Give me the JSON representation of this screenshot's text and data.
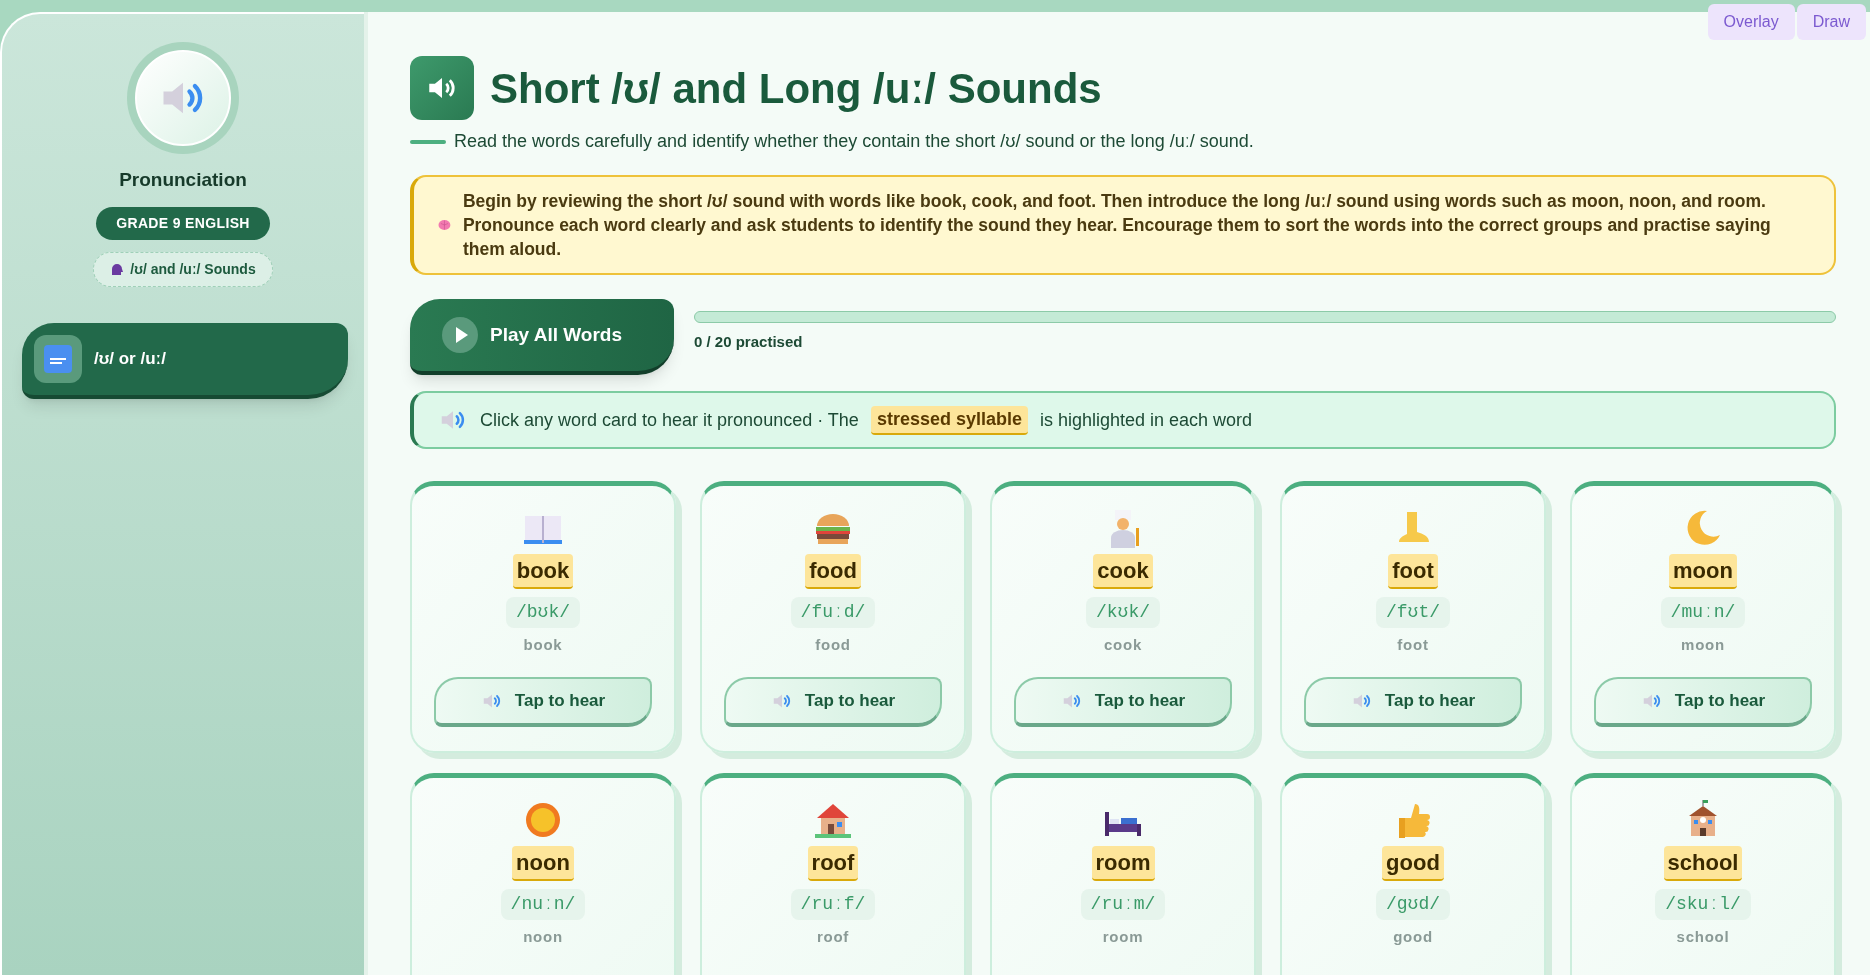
{
  "top_buttons": [
    {
      "label": "Overlay"
    },
    {
      "label": "Draw"
    }
  ],
  "sidebar": {
    "title": "Pronunciation",
    "badge": "GRADE 9 ENGLISH",
    "topic": "/ʊ/ and /uː/ Sounds",
    "items": [
      {
        "label": "/ʊ/ or /uː/",
        "selected": true
      }
    ]
  },
  "header": {
    "title": "Short /ʊ/ and Long /uː/ Sounds",
    "subtitle": "Read the words carefully and identify whether they contain the short /ʊ/ sound or the long /uː/ sound."
  },
  "teacher_note": "Begin by reviewing the short /ʊ/ sound with words like book, cook, and foot. Then introduce the long /uː/ sound using words such as moon, noon, and room. Pronounce each word clearly and ask students to identify the sound they hear. Encourage them to sort the words into the correct groups and practise saying them aloud.",
  "play_all": {
    "label": "Play All Words"
  },
  "progress": {
    "level": 0,
    "reading": "0 / 20 practised"
  },
  "tip": {
    "before": "Click any word card to hear it pronounced · The",
    "highlight": "stressed syllable",
    "after": "is highlighted in each word"
  },
  "cards": [
    {
      "word": "book",
      "ipa": "/bʊk/",
      "spelling": "book",
      "button": "Tap to hear"
    },
    {
      "word": "food",
      "ipa": "/fuːd/",
      "spelling": "food",
      "button": "Tap to hear"
    },
    {
      "word": "cook",
      "ipa": "/kʊk/",
      "spelling": "cook",
      "button": "Tap to hear"
    },
    {
      "word": "foot",
      "ipa": "/fʊt/",
      "spelling": "foot",
      "button": "Tap to hear"
    },
    {
      "word": "moon",
      "ipa": "/muːn/",
      "spelling": "moon",
      "button": "Tap to hear"
    },
    {
      "word": "noon",
      "ipa": "/nuːn/",
      "spelling": "noon"
    },
    {
      "word": "roof",
      "ipa": "/ruːf/",
      "spelling": "roof"
    },
    {
      "word": "room",
      "ipa": "/ruːm/",
      "spelling": "room"
    },
    {
      "word": "good",
      "ipa": "/gʊd/",
      "spelling": "good"
    },
    {
      "word": "school",
      "ipa": "/skuːl/",
      "spelling": "school"
    }
  ]
}
